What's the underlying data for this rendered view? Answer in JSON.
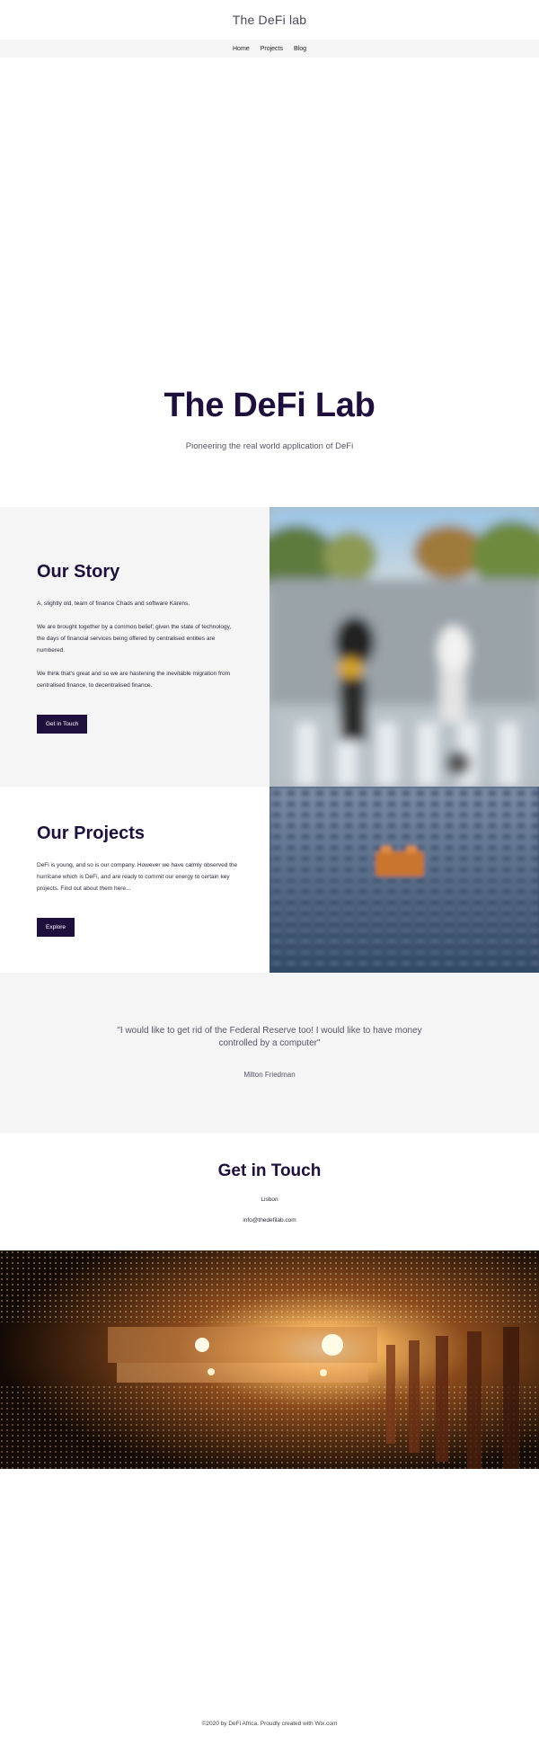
{
  "header": {
    "site_title": "The DeFi lab"
  },
  "nav": {
    "items": [
      "Home",
      "Projects",
      "Blog"
    ]
  },
  "hero": {
    "title": "The DeFi Lab",
    "subtitle": "Pioneering the real world application of DeFi"
  },
  "story": {
    "heading": "Our Story",
    "paragraphs": [
      "A, slightly old, team of finance Chads and software Karens.",
      "We are brought together by a common belief; given the state of technology, the days of financial services being offered by centralised entities are numbered.",
      "We think that's great and so we are hastening the inevitable migration from centralised finance, to decentralised finance."
    ],
    "button_label": "Get in Touch",
    "image_icon": "crosswalk-photo"
  },
  "projects": {
    "heading": "Our Projects",
    "paragraph": "DeFi is young, and so is our company. However we have calmly observed the hurricane which is DeFi, and are ready to commit our energy to certain key projects. Find out about them here...",
    "button_label": "Explore",
    "image_icon": "building-blocks-photo"
  },
  "quote": {
    "text": "\"I would like to get rid of the Federal Reserve too! I would like to have money controlled by a computer\"",
    "author": "Milton Friedman"
  },
  "contact": {
    "heading": "Get in Touch",
    "city": "Lisbon",
    "email": "info@thedefilab.com"
  },
  "banner": {
    "image_icon": "light-tunnel-photo"
  },
  "footer": {
    "text": "©2020 by DeFi Africa. Proudly created with Wix.com"
  },
  "colors": {
    "brand_dark": "#1f0f3d",
    "light_gray": "#f5f5f5",
    "text": "#2a2a3a"
  }
}
